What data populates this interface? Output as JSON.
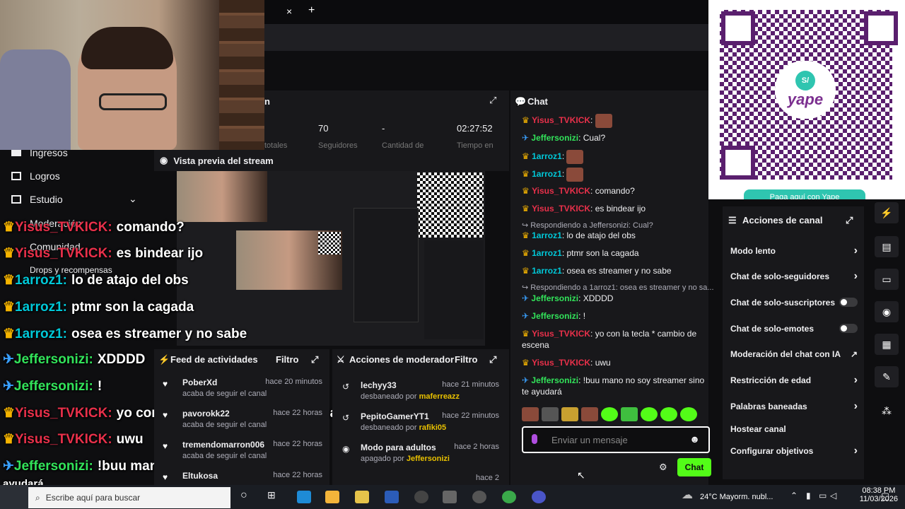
{
  "browser": {
    "tab_close": "×",
    "tab_new": "+"
  },
  "stats": {
    "title_fragment": "n",
    "values": [
      "70",
      "-",
      "02:27:52"
    ],
    "labels": [
      "totales",
      "Seguidores",
      "Cantidad de",
      "Tiempo en"
    ]
  },
  "left_menu": {
    "items": [
      "Ingresos",
      "Logros",
      "Estudio",
      "Moderación",
      "Comunidad",
      "Drops y recompensas"
    ]
  },
  "preview": {
    "title": "Vista previa del stream"
  },
  "overlay_chat": [
    {
      "badge": "crown",
      "user": "Yisus_TVKICK:",
      "msg": "comando?",
      "color": "red"
    },
    {
      "badge": "crown",
      "user": "Yisus_TVKICK:",
      "msg": "es bindear ijo",
      "color": "red"
    },
    {
      "badge": "crown",
      "user": "1arroz1:",
      "msg": "lo de atajo del obs",
      "color": "cyan"
    },
    {
      "badge": "crown",
      "user": "1arroz1:",
      "msg": "ptmr son la cagada",
      "color": "cyan"
    },
    {
      "badge": "crown",
      "user": "1arroz1:",
      "msg": "osea es streamer y no sabe",
      "color": "cyan"
    },
    {
      "badge": "sword",
      "user": "Jeffersonizi:",
      "msg": "XDDDD",
      "color": "green"
    },
    {
      "badge": "sword",
      "user": "Jeffersonizi:",
      "msg": "!",
      "color": "green"
    },
    {
      "badge": "crown",
      "user": "Yisus_TVKICK:",
      "msg": "yo con la tecla * cambio de escena",
      "color": "red"
    },
    {
      "badge": "crown",
      "user": "Yisus_TVKICK:",
      "msg": "uwu",
      "color": "red"
    },
    {
      "badge": "sword",
      "user": "Jeffersonizi:",
      "msg": "!buu mano no soy streamer sino te",
      "color": "green"
    }
  ],
  "overlay_tail": "ayudará",
  "activity": {
    "title": "Feed de actividades",
    "filter": "Filtro",
    "rows": [
      {
        "name": "PoberXd",
        "sub": "acaba de seguir el canal",
        "time": "hace 20 minutos"
      },
      {
        "name": "pavorokk22",
        "sub": "acaba de seguir el canal",
        "time": "hace 22 horas"
      },
      {
        "name": "tremendomarron006",
        "sub": "acaba de seguir el canal",
        "time": "hace 22 horas"
      },
      {
        "name": "Eltukosa",
        "sub": "",
        "time": "hace 22 horas"
      }
    ]
  },
  "modactions": {
    "title": "Acciones de moderador",
    "filter": "Filtro",
    "rows": [
      {
        "name": "lechyy33",
        "sub_pre": "desbaneado por",
        "sub_user": "maferreazz",
        "time": "hace 21 minutos"
      },
      {
        "name": "PepitoGamerYT1",
        "sub_pre": "desbaneado por",
        "sub_user": "rafiki05",
        "time": "hace 22 minutos"
      },
      {
        "name": "Modo para adultos",
        "sub_pre": "apagado por",
        "sub_user": "Jeffersonizi",
        "time": "hace 2 horas"
      },
      {
        "name": "",
        "sub_pre": "",
        "sub_user": "",
        "time": "hace 2"
      }
    ]
  },
  "chat": {
    "title": "Chat",
    "messages": [
      {
        "badge": "crown",
        "user": "Yisus_TVKICK",
        "msg": "",
        "emote": true,
        "color": "red"
      },
      {
        "badge": "sword",
        "user": "Jeffersonizi",
        "msg": "Cual?",
        "color": "green"
      },
      {
        "badge": "crown",
        "user": "1arroz1",
        "msg": "",
        "emote": true,
        "color": "cyan"
      },
      {
        "badge": "crown",
        "user": "1arroz1",
        "msg": "",
        "emote": true,
        "color": "cyan"
      },
      {
        "badge": "crown",
        "user": "Yisus_TVKICK",
        "msg": "comando?",
        "color": "red"
      },
      {
        "badge": "crown",
        "user": "Yisus_TVKICK",
        "msg": "es bindear ijo",
        "color": "red"
      },
      {
        "reply": "Respondiendo a Jeffersonizi: Cual?"
      },
      {
        "badge": "crown",
        "user": "1arroz1",
        "msg": "lo de atajo del obs",
        "color": "cyan"
      },
      {
        "badge": "crown",
        "user": "1arroz1",
        "msg": "ptmr son la cagada",
        "color": "cyan"
      },
      {
        "badge": "crown",
        "user": "1arroz1",
        "msg": "osea es streamer y no sabe",
        "color": "cyan"
      },
      {
        "reply": "Respondiendo a 1arroz1: osea es streamer y no sa..."
      },
      {
        "badge": "sword",
        "user": "Jeffersonizi",
        "msg": "XDDDD",
        "color": "green"
      },
      {
        "badge": "sword",
        "user": "Jeffersonizi",
        "msg": "!",
        "color": "green"
      },
      {
        "badge": "crown",
        "user": "Yisus_TVKICK",
        "msg": "yo con la tecla * cambio de escena",
        "color": "red"
      },
      {
        "badge": "crown",
        "user": "Yisus_TVKICK",
        "msg": "uwu",
        "color": "red"
      },
      {
        "badge": "sword",
        "user": "Jeffersonizi",
        "msg": "!buu mano no soy streamer sino te ayudará",
        "color": "green"
      }
    ],
    "input_placeholder": "Enviar un mensaje",
    "send_label": "Chat"
  },
  "channel_actions": {
    "title": "Acciones de canal",
    "items": [
      {
        "label": "Modo lento",
        "control": "chevron"
      },
      {
        "label": "Chat de solo-seguidores",
        "control": "chevron"
      },
      {
        "label": "Chat de solo-suscriptores",
        "control": "toggle"
      },
      {
        "label": "Chat de solo-emotes",
        "control": "toggle"
      },
      {
        "label": "Moderación del chat con IA",
        "control": "external"
      },
      {
        "label": "Restricción de edad",
        "control": "chevron"
      },
      {
        "label": "Palabras baneadas",
        "control": "chevron"
      },
      {
        "label": "Hostear canal",
        "control": "none"
      },
      {
        "label": "Configurar objetivos",
        "control": "chevron"
      }
    ]
  },
  "qr": {
    "brand": "yape",
    "badge": "S/",
    "caption": "Paga aquí con Yape"
  },
  "taskbar": {
    "search": "Escribe aquí para buscar",
    "weather": "24°C  Mayorm. nubl...",
    "time": "08:38 PM",
    "date": "11/03/2026"
  },
  "colors": {
    "kick_green": "#53fc18",
    "bg": "#0e0e10",
    "panel": "#18181b",
    "yape": "#7b2f8f"
  }
}
